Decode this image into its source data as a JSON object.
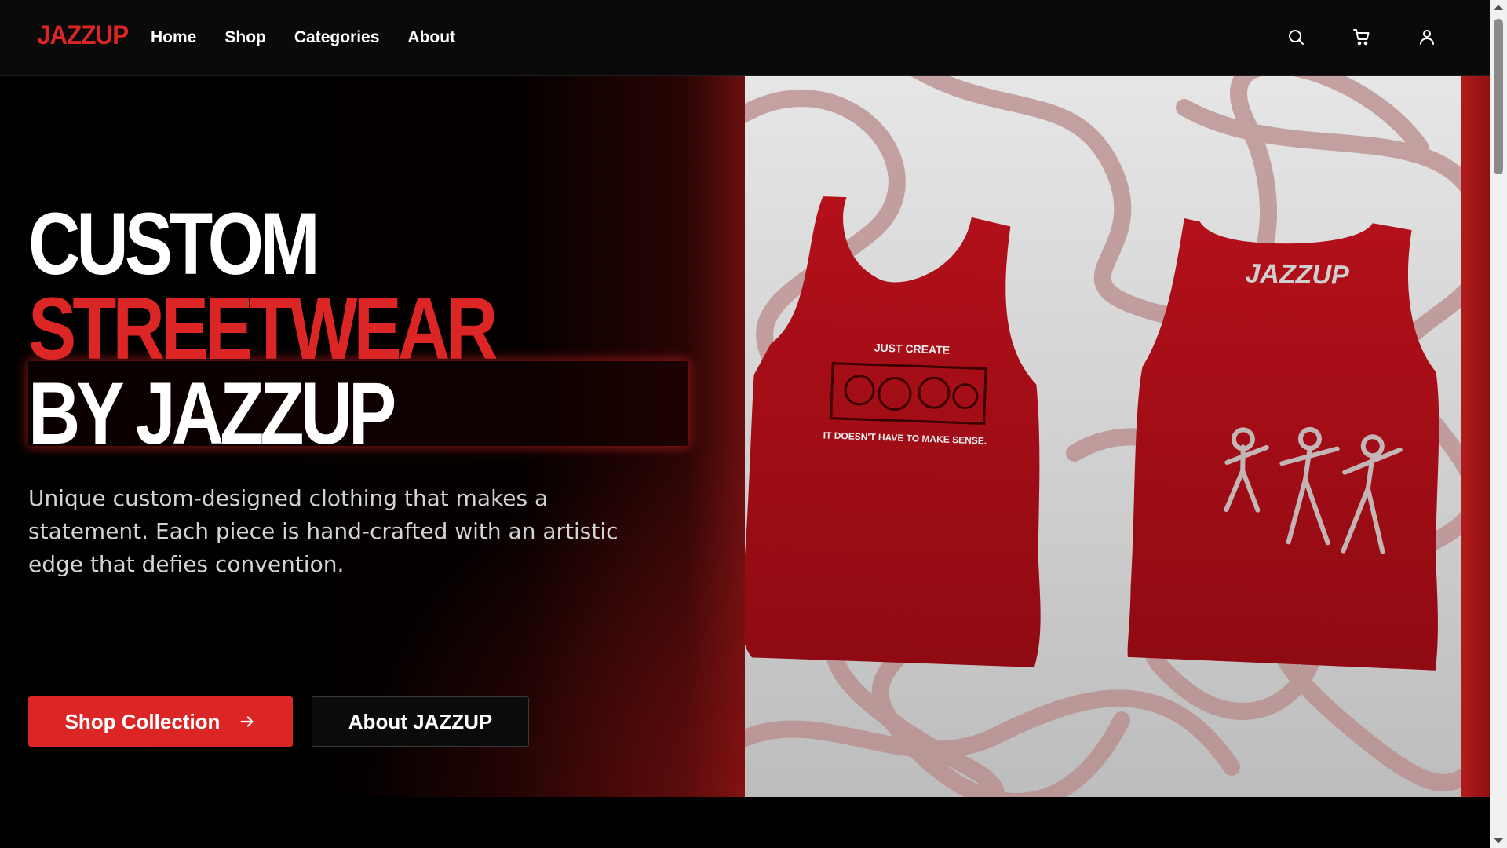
{
  "brand": {
    "logo": "JAZZUP",
    "accent": "#dc2626"
  },
  "nav": {
    "items": [
      "Home",
      "Shop",
      "Categories",
      "About"
    ]
  },
  "header_icons": [
    "search-icon",
    "cart-icon",
    "user-icon"
  ],
  "hero": {
    "headline_line1": "CUSTOM",
    "headline_line2": "STREETWEAR",
    "headline_line3": "BY JAZZUP",
    "tagline": "Unique custom-designed clothing that makes a statement. Each piece is hand-crafted with an artistic edge that defies convention.",
    "primary_button": "Shop Collection",
    "secondary_button": "About JAZZUP"
  },
  "product_image": {
    "front_print_top": "JUST CREATE",
    "front_print_bottom": "IT DOESN'T HAVE TO MAKE SENSE.",
    "back_print_logo": "JAZZUP",
    "shirt_color": "#b3101a"
  }
}
